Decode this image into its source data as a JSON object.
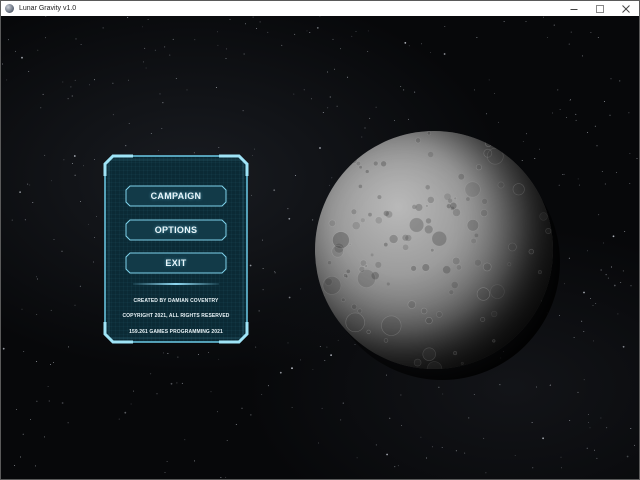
{
  "window": {
    "title": "Lunar Gravity v1.0",
    "icon": "app-moon-icon",
    "controls": [
      "minimize-icon",
      "maximize-icon",
      "close-icon"
    ]
  },
  "menu": {
    "campaign_label": "CAMPAIGN",
    "options_label": "OPTIONS",
    "exit_label": "EXIT"
  },
  "credits": {
    "line1": "CREATED BY DAMIAN COVENTRY",
    "line2": "COPYRIGHT 2021, ALL RIGHTS RESERVED",
    "line3": "159.261 GAMES PROGRAMMING 2021"
  },
  "colors": {
    "panel_fill": "#0b2a35",
    "panel_border": "#6ccbe8",
    "button_fill": "#123a48",
    "text": "#e9f6fb",
    "background": "#07080a"
  }
}
